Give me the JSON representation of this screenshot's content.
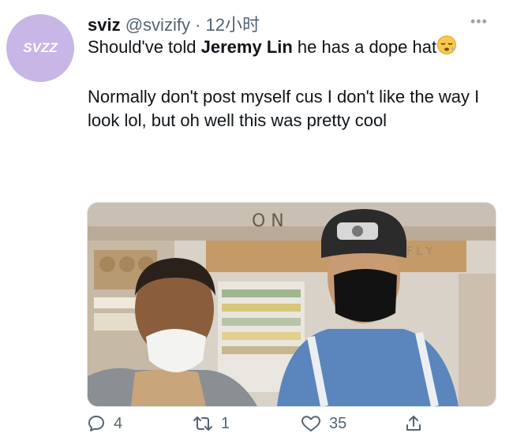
{
  "tweet": {
    "avatar_text": "SVZZ",
    "display_name": "sviz",
    "handle": "@svizify",
    "separator": "·",
    "time": "12小时",
    "line1_before": "Should've told ",
    "line1_bold": "Jeremy Lin",
    "line1_after": " he has a dope hat",
    "line2": "Normally don't post myself cus I don't like the way I look lol, but oh well this was pretty cool",
    "photo": {
      "store_sign": "O N",
      "store_sign2": "F L Y"
    }
  },
  "actions": {
    "reply_count": "4",
    "retweet_count": "1",
    "like_count": "35"
  },
  "icons": [
    "more-icon",
    "sleepy-emoji-icon",
    "reply-icon",
    "retweet-icon",
    "like-icon",
    "share-icon"
  ],
  "colors": {
    "avatar": "#c8b6e6",
    "muted": "#536471"
  }
}
